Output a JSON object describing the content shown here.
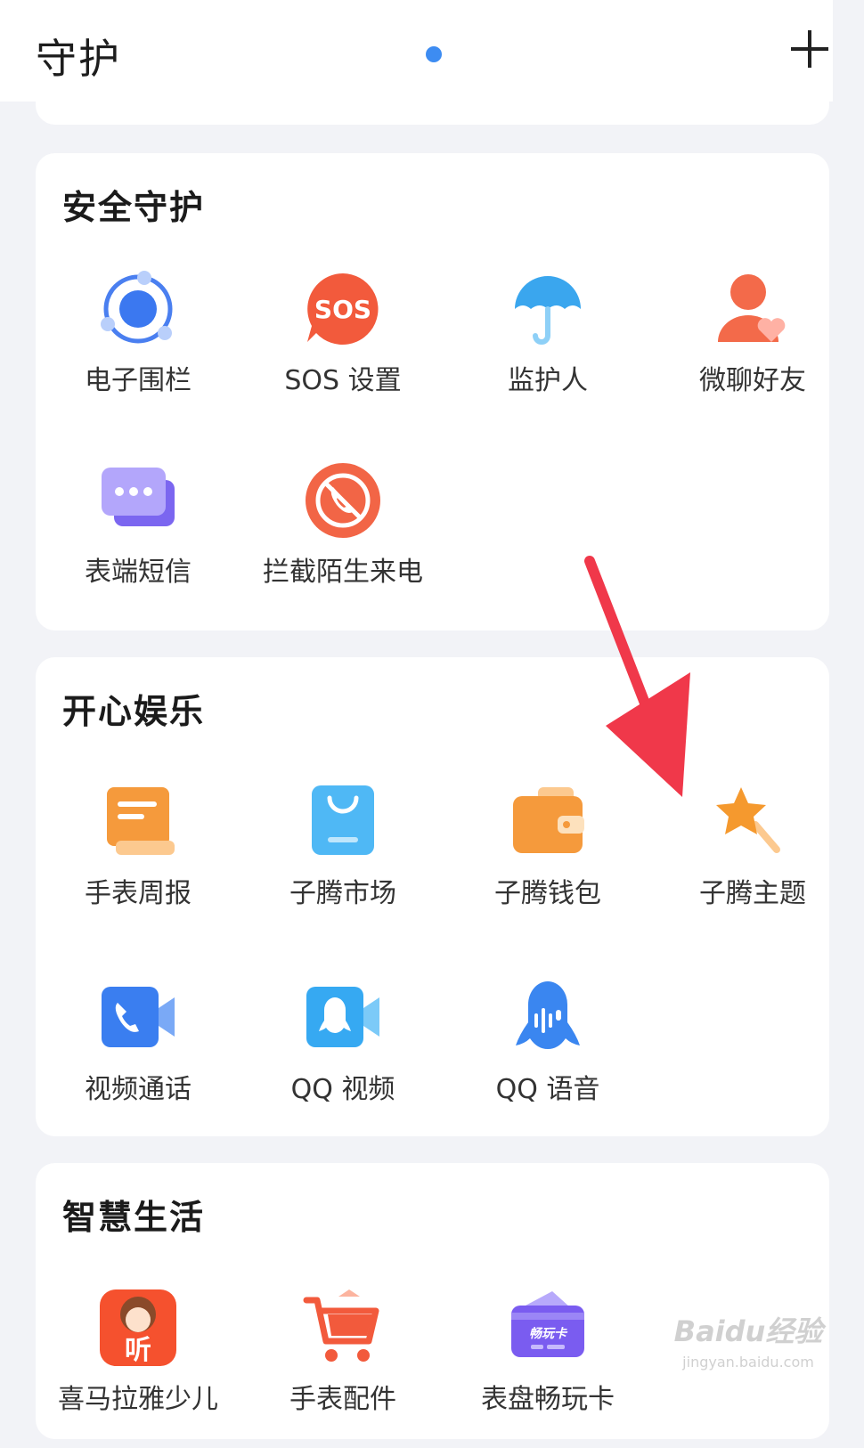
{
  "header": {
    "title": "守护"
  },
  "sections": [
    {
      "title": "安全守护",
      "items": [
        {
          "label": "电子围栏",
          "icon": "geofence-icon"
        },
        {
          "label": "SOS 设置",
          "icon": "sos-icon",
          "icon_text": "SOS"
        },
        {
          "label": "监护人",
          "icon": "umbrella-icon"
        },
        {
          "label": "微聊好友",
          "icon": "friend-heart-icon"
        },
        {
          "label": "表端短信",
          "icon": "message-bubble-icon"
        },
        {
          "label": "拦截陌生来电",
          "icon": "block-call-icon"
        }
      ]
    },
    {
      "title": "开心娱乐",
      "items": [
        {
          "label": "手表周报",
          "icon": "report-scroll-icon"
        },
        {
          "label": "子腾市场",
          "icon": "shopping-bag-icon"
        },
        {
          "label": "子腾钱包",
          "icon": "wallet-icon"
        },
        {
          "label": "子腾主题",
          "icon": "star-wand-icon"
        },
        {
          "label": "视频通话",
          "icon": "video-call-icon"
        },
        {
          "label": "QQ 视频",
          "icon": "qq-video-icon"
        },
        {
          "label": "QQ 语音",
          "icon": "qq-voice-icon"
        }
      ]
    },
    {
      "title": "智慧生活",
      "items": [
        {
          "label": "喜马拉雅少儿",
          "icon": "ximalaya-kids-icon",
          "icon_text": "听"
        },
        {
          "label": "手表配件",
          "icon": "shopping-cart-icon"
        },
        {
          "label": "表盘畅玩卡",
          "icon": "watchface-card-icon",
          "icon_text": "畅玩卡"
        }
      ]
    }
  ],
  "watermark": {
    "main": "Baidu经验",
    "sub": "jingyan.baidu.com"
  },
  "colors": {
    "accent_dot": "#3d8cf2",
    "arrow": "#f0384a"
  }
}
